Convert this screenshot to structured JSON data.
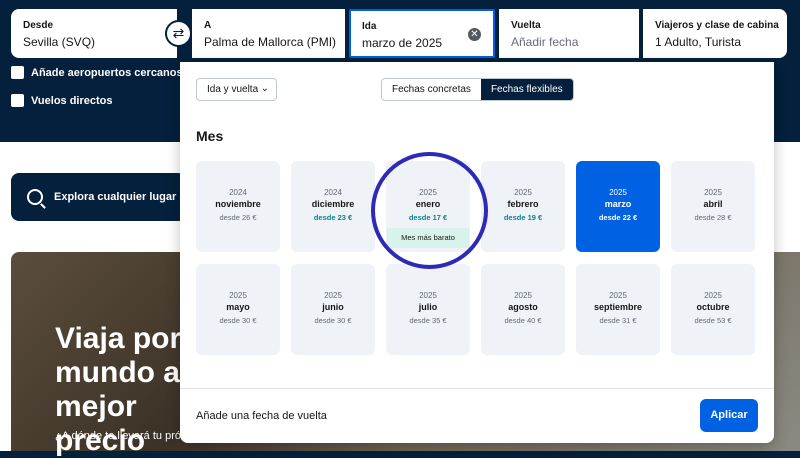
{
  "search": {
    "from": {
      "label": "Desde",
      "value": "Sevilla (SVQ)"
    },
    "to": {
      "label": "A",
      "value": "Palma de Mallorca (PMI)"
    },
    "depart": {
      "label": "Ida",
      "value": "marzo de 2025"
    },
    "return": {
      "label": "Vuelta",
      "placeholder": "Añadir fecha"
    },
    "travellers": {
      "label": "Viajeros y clase de cabina",
      "value": "1 Adulto, Turista"
    },
    "swap_icon": "⇄",
    "clear_icon": "✕"
  },
  "options": {
    "nearby_airports": "Añade aeropuertos cercanos",
    "direct_flights": "Vuelos directos"
  },
  "explore": {
    "label": "Explora cualquier lugar"
  },
  "hero": {
    "title": "Viaja por el mundo al mejor precio",
    "subtitle": "¿A dónde te llevará tu próximo viaje?"
  },
  "picker": {
    "trip_type": "Ida y vuelta",
    "tabs": [
      "Fechas concretas",
      "Fechas flexibles"
    ],
    "active_tab": "Fechas flexibles",
    "section_title": "Mes",
    "months": [
      {
        "year": "2024",
        "month": "noviembre",
        "price": "desde 26 €",
        "cheap_price": false
      },
      {
        "year": "2024",
        "month": "diciembre",
        "price": "desde 23 €",
        "cheap_price": true
      },
      {
        "year": "2025",
        "month": "enero",
        "price": "desde 17 €",
        "cheap_price": true,
        "badge": "Mes más barato"
      },
      {
        "year": "2025",
        "month": "febrero",
        "price": "desde 19 €",
        "cheap_price": true
      },
      {
        "year": "2025",
        "month": "marzo",
        "price": "desde 22 €",
        "cheap_price": true,
        "selected": true
      },
      {
        "year": "2025",
        "month": "abril",
        "price": "desde 28 €",
        "cheap_price": false
      },
      {
        "year": "2025",
        "month": "mayo",
        "price": "desde 30 €",
        "cheap_price": false
      },
      {
        "year": "2025",
        "month": "junio",
        "price": "desde 30 €",
        "cheap_price": false
      },
      {
        "year": "2025",
        "month": "julio",
        "price": "desde 35 €",
        "cheap_price": false
      },
      {
        "year": "2025",
        "month": "agosto",
        "price": "desde 40 €",
        "cheap_price": false
      },
      {
        "year": "2025",
        "month": "septiembre",
        "price": "desde 31 €",
        "cheap_price": false
      },
      {
        "year": "2025",
        "month": "octubre",
        "price": "desde 53 €",
        "cheap_price": false
      }
    ],
    "footer_text": "Añade una fecha de vuelta",
    "apply_label": "Aplicar"
  },
  "colors": {
    "navy": "#05203c",
    "primary": "#0062e3",
    "green_price": "#0c838a",
    "highlight_circle": "#2e2ab6"
  }
}
